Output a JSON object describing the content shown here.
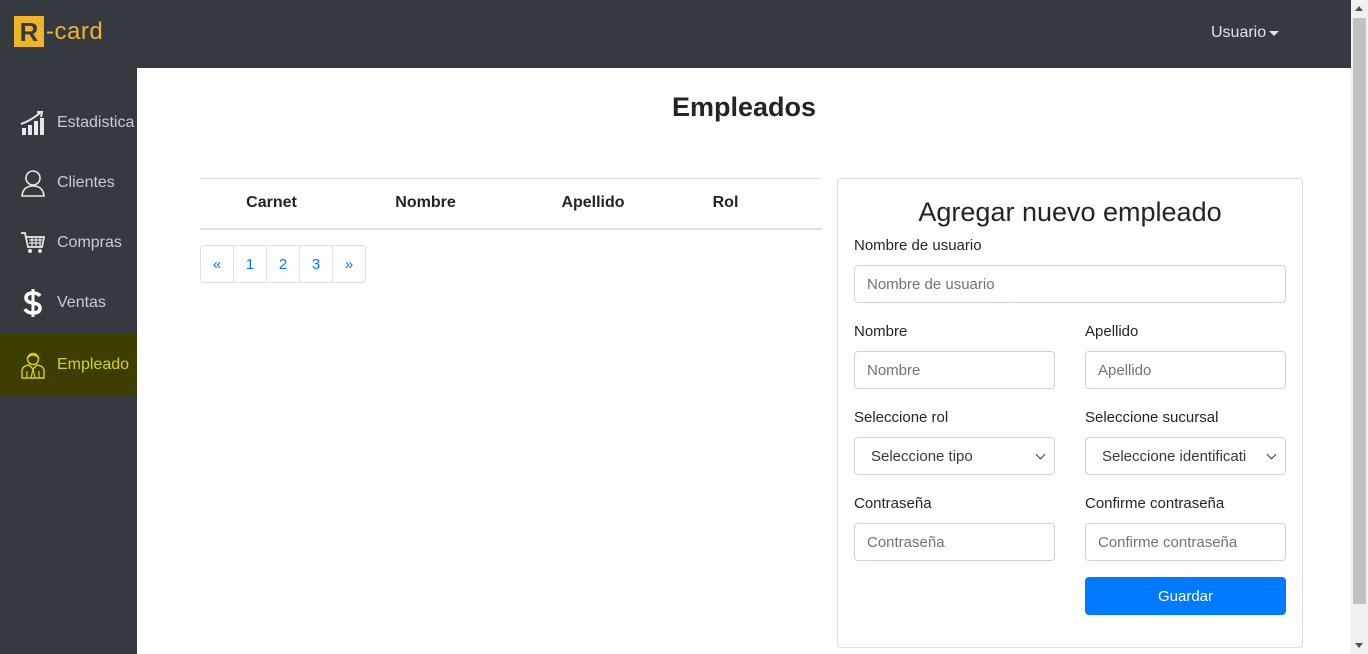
{
  "brand": {
    "logo_letter": "R",
    "logo_text": "-card"
  },
  "header": {
    "user_menu": "Usuario"
  },
  "sidebar": {
    "items": [
      {
        "label": "Estadistica",
        "icon": "bar-chart-icon"
      },
      {
        "label": "Clientes",
        "icon": "user-icon"
      },
      {
        "label": "Compras",
        "icon": "shopping-cart-icon"
      },
      {
        "label": "Ventas",
        "icon": "dollar-icon"
      },
      {
        "label": "Empleado",
        "icon": "employee-icon",
        "active": true
      }
    ]
  },
  "main": {
    "title": "Empleados",
    "table": {
      "columns": [
        "Carnet",
        "Nombre",
        "Apellido",
        "Rol"
      ],
      "rows": []
    },
    "pagination": [
      "«",
      "1",
      "2",
      "3",
      "»"
    ]
  },
  "form": {
    "title": "Agregar nuevo empleado",
    "username": {
      "label": "Nombre de usuario",
      "placeholder": "Nombre de usuario"
    },
    "first_name": {
      "label": "Nombre",
      "placeholder": "Nombre"
    },
    "last_name": {
      "label": "Apellido",
      "placeholder": "Apellido"
    },
    "role": {
      "label": "Seleccione rol",
      "selected": "Seleccione tipo"
    },
    "branch": {
      "label": "Seleccione sucursal",
      "selected": "Seleccione identificati"
    },
    "password": {
      "label": "Contraseña",
      "placeholder": "Contraseña"
    },
    "confirm_password": {
      "label": "Confirme contraseña",
      "placeholder": "Confirme contraseña"
    },
    "submit_label": "Guardar"
  },
  "colors": {
    "topbar": "#343a40",
    "accent": "#f0b429",
    "active_item": "#d6d21c",
    "primary": "#007bff"
  }
}
